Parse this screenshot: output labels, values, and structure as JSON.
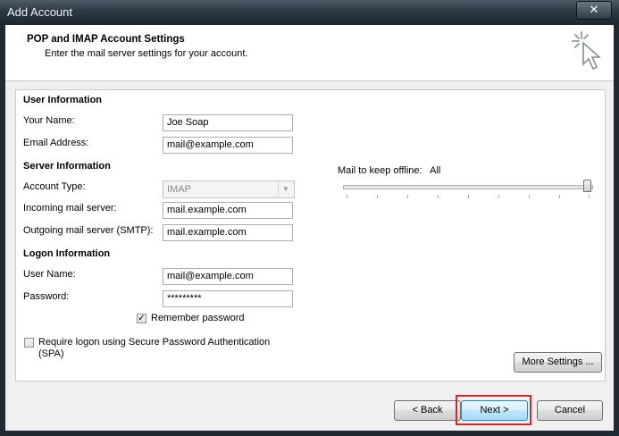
{
  "window": {
    "title": "Add Account",
    "close_glyph": "✕"
  },
  "header": {
    "title": "POP and IMAP Account Settings",
    "subtitle": "Enter the mail server settings for your account.",
    "icon": "cursor-click-icon"
  },
  "sections": {
    "user_info": "User Information",
    "server_info": "Server Information",
    "logon_info": "Logon Information"
  },
  "fields": {
    "your_name": {
      "label": "Your Name:",
      "value": "Joe Soap"
    },
    "email": {
      "label": "Email Address:",
      "value": "mail@example.com"
    },
    "account_type": {
      "label": "Account Type:",
      "value": "IMAP"
    },
    "incoming": {
      "label": "Incoming mail server:",
      "value": "mail.example.com"
    },
    "outgoing": {
      "label": "Outgoing mail server (SMTP):",
      "value": "mail.example.com"
    },
    "username": {
      "label": "User Name:",
      "value": "mail@example.com"
    },
    "password": {
      "label": "Password:",
      "value": "*********"
    }
  },
  "remember_password": {
    "label": "Remember password",
    "checked": true,
    "glyph": "✓"
  },
  "spa": {
    "label_line1": "Require logon using Secure Password Authentication",
    "label_line2": "(SPA)",
    "checked": false
  },
  "offline": {
    "label": "Mail to keep offline:",
    "value": "All",
    "slider_fraction": 1.0
  },
  "buttons": {
    "more_settings": "More Settings ...",
    "back": "< Back",
    "next": "Next >",
    "cancel": "Cancel"
  }
}
